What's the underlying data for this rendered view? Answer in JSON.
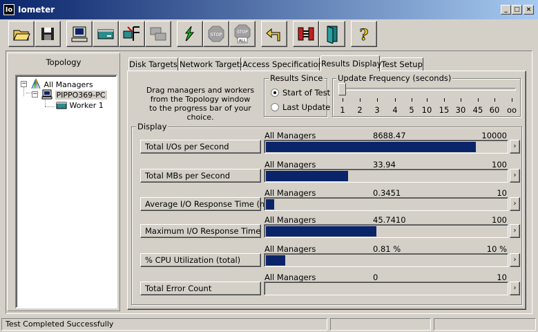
{
  "window": {
    "title": "Iometer",
    "icon_text": "Io"
  },
  "toolbar": {
    "buttons": [
      {
        "name": "open-icon"
      },
      {
        "name": "save-icon"
      },
      {
        "name": "new-manager-icon"
      },
      {
        "name": "new-disk-worker-icon"
      },
      {
        "name": "new-network-worker-icon"
      },
      {
        "name": "duplicate-worker-icon"
      },
      {
        "name": "start-tests-icon"
      },
      {
        "name": "stop-icon"
      },
      {
        "name": "stop-all-icon"
      },
      {
        "name": "reset-workers-icon"
      },
      {
        "name": "disconnect-icon"
      },
      {
        "name": "exit-icon"
      },
      {
        "name": "help-icon"
      }
    ],
    "stop_text": "STOP",
    "stop_all_text": "STOP",
    "stop_all_sub": "ALL",
    "help_text": "?"
  },
  "topology": {
    "title": "Topology",
    "items": [
      {
        "label": "All Managers"
      },
      {
        "label": "PIPPO369-PC"
      },
      {
        "label": "Worker 1"
      }
    ],
    "toggles": [
      "−",
      "−"
    ]
  },
  "tabs": [
    {
      "label": "Disk Targets"
    },
    {
      "label": "Network Targets"
    },
    {
      "label": "Access Specifications"
    },
    {
      "label": "Results Display"
    },
    {
      "label": "Test Setup"
    }
  ],
  "results": {
    "instructions": [
      "Drag managers and workers",
      "from the Topology window",
      "to the progress bar of your choice."
    ],
    "results_since": {
      "title": "Results Since",
      "options": [
        "Start of Test",
        "Last Update"
      ],
      "selected_index": 0
    },
    "update_frequency": {
      "title": "Update Frequency (seconds)",
      "ticks": [
        "1",
        "2",
        "3",
        "4",
        "5",
        "10",
        "15",
        "30",
        "45",
        "60",
        "oo"
      ],
      "selected": "1"
    },
    "display_title": "Display",
    "metrics": [
      {
        "button": "Total I/Os per Second",
        "source": "All Managers",
        "value": "8688.47",
        "max": "10000",
        "fraction": 0.8688
      },
      {
        "button": "Total MBs per Second",
        "source": "All Managers",
        "value": "33.94",
        "max": "100",
        "fraction": 0.3394
      },
      {
        "button": "Average I/O Response Time (ms)",
        "source": "All Managers",
        "value": "0.3451",
        "max": "10",
        "fraction": 0.0345
      },
      {
        "button": "Maximum I/O Response Time (ms)",
        "source": "All Managers",
        "value": "45.7410",
        "max": "100",
        "fraction": 0.4574
      },
      {
        "button": "% CPU Utilization (total)",
        "source": "All Managers",
        "value": "0.81 %",
        "max": "10 %",
        "fraction": 0.081
      },
      {
        "button": "Total Error Count",
        "source": "All Managers",
        "value": "0",
        "max": "10",
        "fraction": 0
      }
    ],
    "arrow": "›"
  },
  "status": {
    "text": "Test Completed Successfully"
  },
  "colors": {
    "titlebar_start": "#0a246a",
    "titlebar_end": "#a6caf0",
    "bar_fill": "#0a246a",
    "face": "#d4d0c8"
  }
}
